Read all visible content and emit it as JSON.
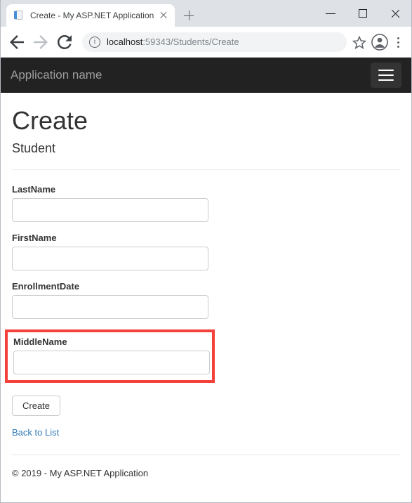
{
  "browser": {
    "tab": {
      "title": "Create - My ASP.NET Application",
      "favicon": "page-document-icon",
      "close": "close-icon"
    },
    "new_tab": "new-tab-icon",
    "window_controls": {
      "minimize": "minimize-icon",
      "maximize": "maximize-icon",
      "close": "window-close-icon"
    },
    "toolbar": {
      "back": "back-arrow-icon",
      "forward": "forward-arrow-icon",
      "reload": "reload-icon",
      "site_info": "info-circle-icon",
      "url_host": "localhost",
      "url_path": ":59343/Students/Create",
      "url_full": "localhost:59343/Students/Create",
      "bookmark": "star-icon",
      "profile": "account-avatar-icon",
      "menu": "three-dots-menu-icon"
    }
  },
  "page": {
    "navbar": {
      "brand": "Application name",
      "toggle": "hamburger-menu-icon"
    },
    "title": "Create",
    "subtitle": "Student",
    "form": {
      "fields": [
        {
          "label": "LastName",
          "value": "",
          "placeholder": ""
        },
        {
          "label": "FirstName",
          "value": "",
          "placeholder": ""
        },
        {
          "label": "EnrollmentDate",
          "value": "",
          "placeholder": ""
        }
      ],
      "highlighted_field": {
        "label": "MiddleName",
        "value": "",
        "placeholder": ""
      },
      "submit_label": "Create",
      "back_link": "Back to List"
    },
    "footer": "© 2019 - My ASP.NET Application"
  },
  "annotation": {
    "highlight_color": "#f5413c"
  }
}
